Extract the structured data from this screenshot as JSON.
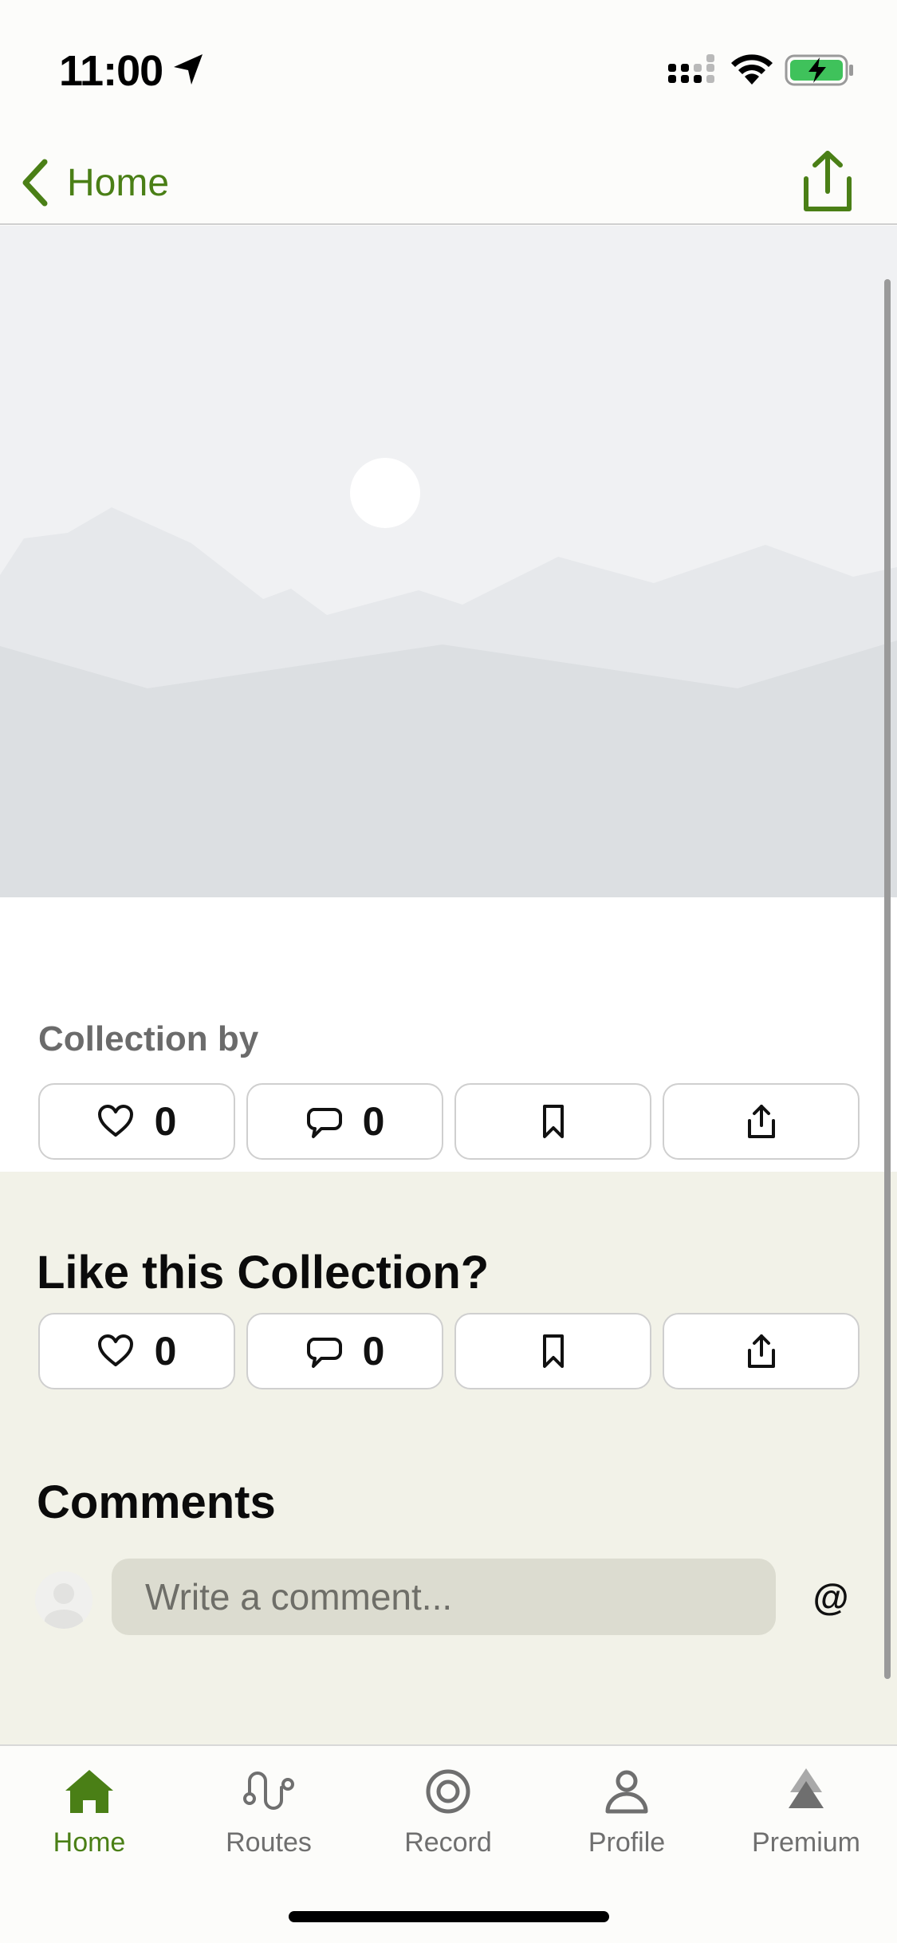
{
  "status_bar": {
    "time": "11:00",
    "icons": [
      "location-arrow-icon",
      "cellular-signal-icon",
      "wifi-icon",
      "battery-charging-icon"
    ]
  },
  "nav": {
    "back_label": "Home",
    "share_icon": "share-icon"
  },
  "collection": {
    "section_label": "Collection by",
    "actions": {
      "likes": "0",
      "comments": "0"
    }
  },
  "engage": {
    "title": "Like this Collection?",
    "actions": {
      "likes": "0",
      "comments": "0"
    }
  },
  "comments": {
    "title": "Comments",
    "input_placeholder": "Write a comment...",
    "mention_label": "@"
  },
  "tabs": [
    {
      "label": "Home",
      "icon": "home-icon",
      "active": true
    },
    {
      "label": "Routes",
      "icon": "routes-icon",
      "active": false
    },
    {
      "label": "Record",
      "icon": "record-icon",
      "active": false
    },
    {
      "label": "Profile",
      "icon": "profile-icon",
      "active": false
    },
    {
      "label": "Premium",
      "icon": "premium-icon",
      "active": false
    }
  ],
  "colors": {
    "accent": "#4a7f16",
    "cream_background": "#f2f2e8",
    "hero_placeholder": "#f0f1f3"
  }
}
